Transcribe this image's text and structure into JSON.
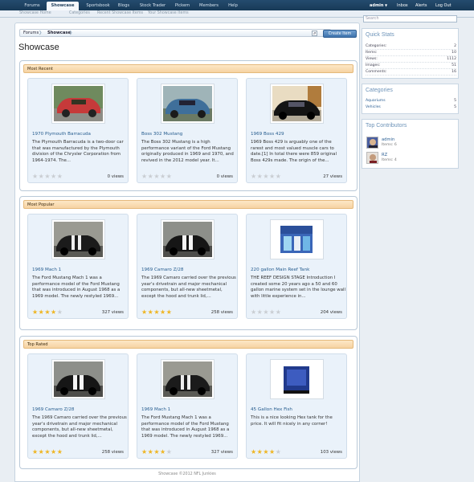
{
  "nav": {
    "tabs": [
      "Forums",
      "Showcase",
      "Sportsbook",
      "Blogs",
      "Stock Trader",
      "Pickem",
      "Members",
      "Help"
    ],
    "active": "Showcase",
    "user": "admin",
    "inbox": "Inbox",
    "alerts": "Alerts",
    "logout": "Log Out"
  },
  "subnav": {
    "items": [
      "Showcase Home",
      "Categories",
      "Recent Showcase Items",
      "Your Showcase Items"
    ]
  },
  "breadcrumb": {
    "home": "Forums",
    "current": "Showcase"
  },
  "create_button": "Create Item",
  "page_title": "Showcase",
  "sections": [
    {
      "title": "Most Recent",
      "items": [
        {
          "title": "1970 Plymouth Barracuda",
          "desc": "The Plymouth Barracuda is a two-door car that was manufactured by the Plymouth division of the Chrysler Corporation from 1964-1974. The...",
          "rating": 0,
          "views": "0 views",
          "thumb": "red-car"
        },
        {
          "title": "Boss 302 Mustang",
          "desc": "The Boss 302 Mustang is a high performance variant of the Ford Mustang originally produced in 1969 and 1970, and revived in the 2012 model year. It...",
          "rating": 0,
          "views": "0 views",
          "thumb": "blue-car"
        },
        {
          "title": "1969 Boss 429",
          "desc": "1969 Boss 429 is arguably one of the rarest and most valued muscle cars to date.[1] In total there were 859 original Boss 429s made. The origin of the...",
          "rating": 0,
          "views": "27 views",
          "thumb": "black-car"
        }
      ]
    },
    {
      "title": "Most Popular",
      "items": [
        {
          "title": "1969 Mach 1",
          "desc": "The Ford Mustang Mach 1 was a performance model of the Ford Mustang that was introduced in August 1968 as a 1969 model. The newly restyled 1969...",
          "rating": 4,
          "views": "327 views",
          "thumb": "stripe-car"
        },
        {
          "title": "1969 Camaro Z/28",
          "desc": "The 1969 Camaro carried over the previous year's drivetrain and major mechanical components, but all-new sheetmetal, except the hood and trunk lid,...",
          "rating": 5,
          "views": "258 views",
          "thumb": "camaro"
        },
        {
          "title": "220 gallon Main Reef Tank",
          "desc": "THE REEF DESIGN STAGE Introduction I created some 20 years ago a 50 and 60 gallon marine system set in the lounge wall with little experience in...",
          "rating": 0,
          "views": "204 views",
          "thumb": "reef-tank"
        }
      ]
    },
    {
      "title": "Top Rated",
      "items": [
        {
          "title": "1969 Camaro Z/28",
          "desc": "The 1969 Camaro carried over the previous year's drivetrain and major mechanical components, but all-new sheetmetal, except the hood and trunk lid,...",
          "rating": 5,
          "views": "258 views",
          "thumb": "camaro"
        },
        {
          "title": "1969 Mach 1",
          "desc": "The Ford Mustang Mach 1 was a performance model of the Ford Mustang that was introduced in August 1968 as a 1969 model. The newly restyled 1969...",
          "rating": 4,
          "views": "327 views",
          "thumb": "stripe-car"
        },
        {
          "title": "45 Gallon Hex Fish",
          "desc": "This is a nice looking Hex tank for the price. It will fit nicely in any corner!",
          "rating": 4,
          "views": "103 views",
          "thumb": "hex-tank"
        }
      ]
    }
  ],
  "footer": "Showcase ©2012 NFL Junkies",
  "sidebar": {
    "search_placeholder": "Search",
    "quick_stats": {
      "title": "Quick Stats",
      "rows": [
        {
          "label": "Categories:",
          "value": "2"
        },
        {
          "label": "Items:",
          "value": "10"
        },
        {
          "label": "Views:",
          "value": "1112"
        },
        {
          "label": "Images:",
          "value": "51"
        },
        {
          "label": "Comments:",
          "value": "16"
        }
      ]
    },
    "categories": {
      "title": "Categories",
      "rows": [
        {
          "label": "Aquariums",
          "value": "5"
        },
        {
          "label": "Vehicles",
          "value": "5"
        }
      ]
    },
    "top_contributors": {
      "title": "Top Contributors",
      "rows": [
        {
          "name": "admin",
          "items": "Items: 6"
        },
        {
          "name": "RZ",
          "items": "Items: 4"
        }
      ]
    }
  }
}
